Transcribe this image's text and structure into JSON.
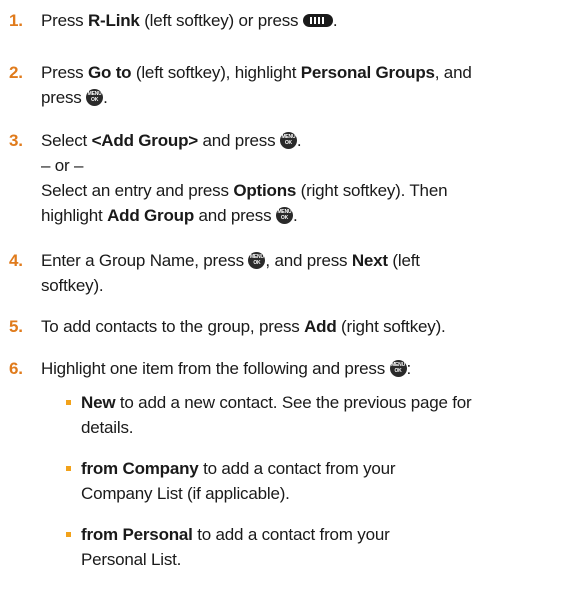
{
  "steps": [
    {
      "num": "1.",
      "parts": {
        "a": "Press ",
        "b": "R-Link",
        "c": " (left softkey) or press ",
        "d": "."
      }
    },
    {
      "num": "2.",
      "l1": {
        "a": "Press ",
        "b": "Go to",
        "c": " (left softkey), highlight ",
        "d": "Personal Groups",
        "e": ", and"
      },
      "l2": {
        "a": "press ",
        "b": "."
      }
    },
    {
      "num": "3.",
      "l1": {
        "a": "Select ",
        "b": "<Add Group>",
        "c": " and press ",
        "d": "."
      },
      "or": "– or –",
      "l3": {
        "a": "Select an entry and press ",
        "b": "Options",
        "c": " (right softkey). Then"
      },
      "l4": {
        "a": "highlight ",
        "b": "Add Group",
        "c": " and press ",
        "d": "."
      }
    },
    {
      "num": "4.",
      "l1": {
        "a": "Enter a Group Name, press ",
        "b": ", and press ",
        "c": "Next",
        "d": " (left"
      },
      "l2": "softkey)."
    },
    {
      "num": "5.",
      "l1": {
        "a": "To add contacts to the group, press ",
        "b": "Add",
        "c": " (right softkey)."
      }
    },
    {
      "num": "6.",
      "l1": {
        "a": "Highlight one item from the following and press ",
        "b": ":"
      }
    }
  ],
  "bullets": [
    {
      "bold": "New",
      "rest1": " to add a new contact. See the previous page for",
      "rest2": "details."
    },
    {
      "bold": "from Company",
      "rest1": " to add a contact from your",
      "rest2": "Company List (if applicable)."
    },
    {
      "bold": "from Personal",
      "rest1": " to add a contact from your",
      "rest2": "Personal List."
    }
  ],
  "icons": {
    "rlink": "r-link-key-icon",
    "menu": "menu-ok-key-icon"
  },
  "colors": {
    "step_number": "#e07b1c",
    "bullet": "#f2a21a"
  }
}
